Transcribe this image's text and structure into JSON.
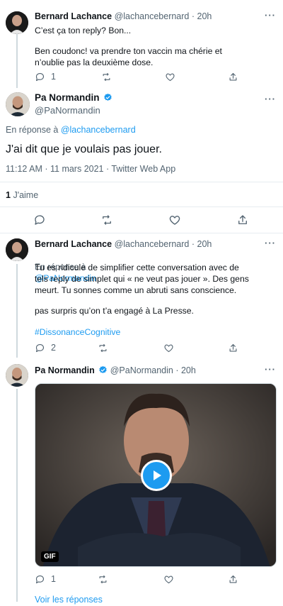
{
  "colors": {
    "accent": "#1d9bf0",
    "secondary_text": "#536471",
    "primary_text": "#0f1419",
    "divider": "#e6ecf0"
  },
  "tweet1": {
    "name": "Bernard Lachance",
    "handle": "@lachancebernard",
    "time": "· 20h",
    "more": "···",
    "line1": "C’est ça ton reply? Bon...",
    "line2": "Ben coudonc! va prendre ton vaccin ma chérie et\nn’oublie pas la deuxième dose.",
    "reply_count": "1"
  },
  "main_tweet": {
    "name": "Pa Normandin",
    "handle": "@PaNormandin",
    "more": "···",
    "reply_prefix": "En réponse à",
    "reply_handle": "@lachancebernard",
    "text": "J'ai dit que je voulais pas jouer.",
    "timestamp": "11:12 AM · 11 mars 2021 · Twitter Web App",
    "likes_count": "1",
    "likes_label": "J'aime"
  },
  "tweet3": {
    "name": "Bernard Lachance",
    "handle": "@lachancebernard",
    "time": "· 20h",
    "more": "···",
    "reply_prefix": "En réponse à",
    "reply_handle": "@PaNormandin",
    "para1": "Tu es ridicule de simplifier cette conversation avec de\ntels reply de simplet qui « ne veut pas jouer ».  Des gens\nmeurt. Tu sonnes comme un abruti sans conscience.",
    "para2": "pas surpris qu’on t’a engagé à La Presse.",
    "hashtag": "#DissonanceCognitive",
    "reply_count": "2"
  },
  "tweet4": {
    "name": "Pa Normandin",
    "handle": "@PaNormandin",
    "time": "· 20h",
    "more": "···",
    "gif_label": "GIF",
    "reply_count": "1"
  },
  "see_replies": "Voir les réponses"
}
